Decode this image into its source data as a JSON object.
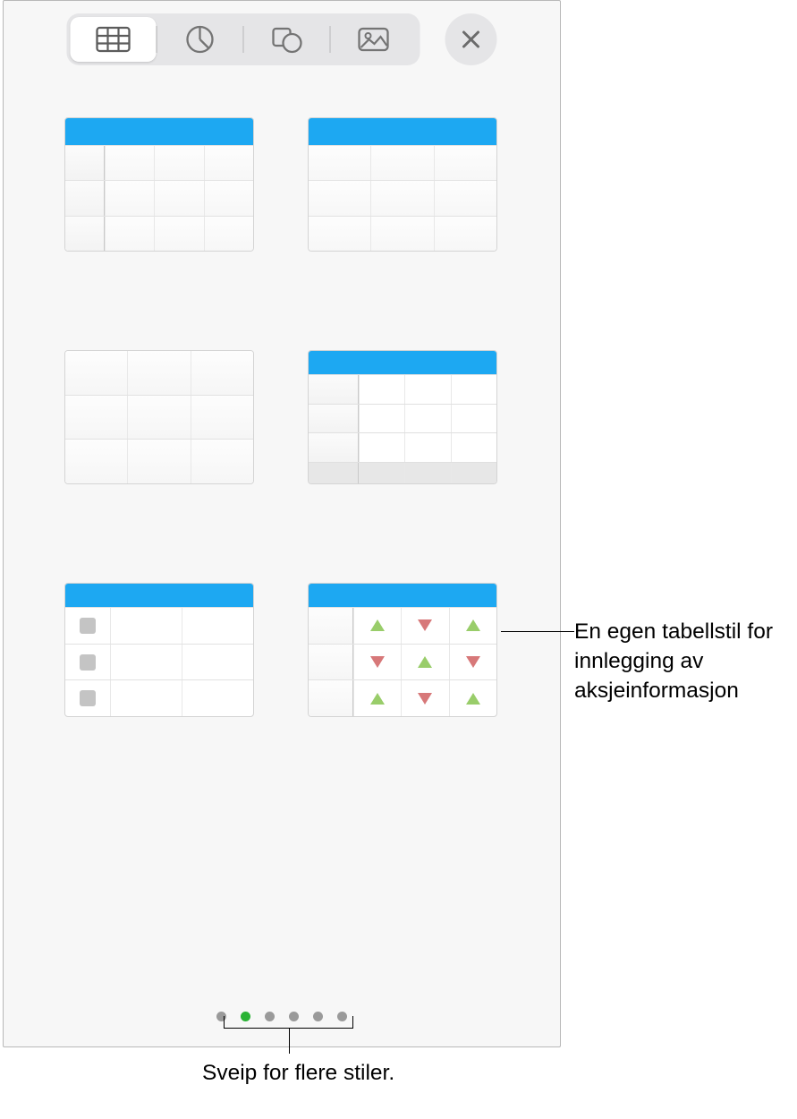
{
  "toolbar": {
    "tabs": [
      "table",
      "chart",
      "shape",
      "media"
    ],
    "active_index": 0
  },
  "table_styles": [
    {
      "id": "header-row-and-column"
    },
    {
      "id": "header-row"
    },
    {
      "id": "plain"
    },
    {
      "id": "header-footer"
    },
    {
      "id": "checklist"
    },
    {
      "id": "stock"
    }
  ],
  "pager": {
    "count": 6,
    "active_index": 1
  },
  "callouts": {
    "stock_style": "En egen tabellstil for innlegging av aksjeinformasjon",
    "swipe_hint": "Sveip for flere stiler."
  }
}
